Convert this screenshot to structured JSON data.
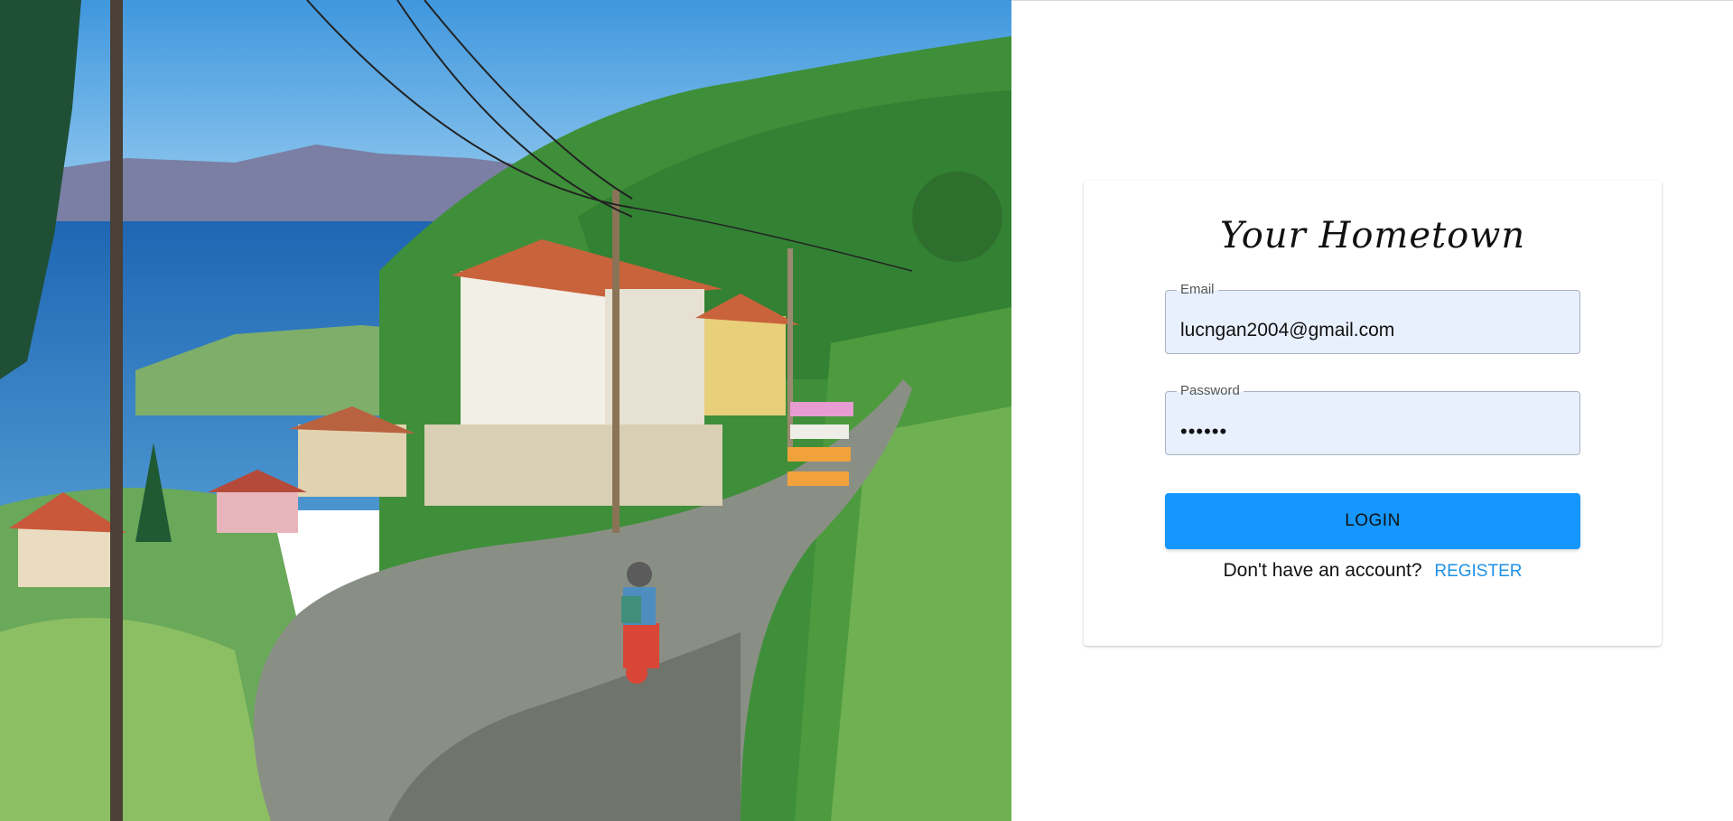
{
  "hero": {
    "image_icon": "landscape-illustration",
    "colors": {
      "sky": "#5aa7e6",
      "sea": "#2e7bc6",
      "hills": "#3f8f3a",
      "road": "#8a8f86",
      "scooter": "#d94635"
    }
  },
  "login": {
    "brand": "Your Hometown",
    "email": {
      "label": "Email",
      "value": "lucngan2004@gmail.com"
    },
    "password": {
      "label": "Password",
      "value": "••••••"
    },
    "login_button": "LOGIN",
    "register_prompt": "Don't have an account?",
    "register_link": "REGISTER"
  },
  "colors": {
    "accent": "#1597ff",
    "link": "#1e90e6",
    "field_bg": "#e8f0fe"
  }
}
